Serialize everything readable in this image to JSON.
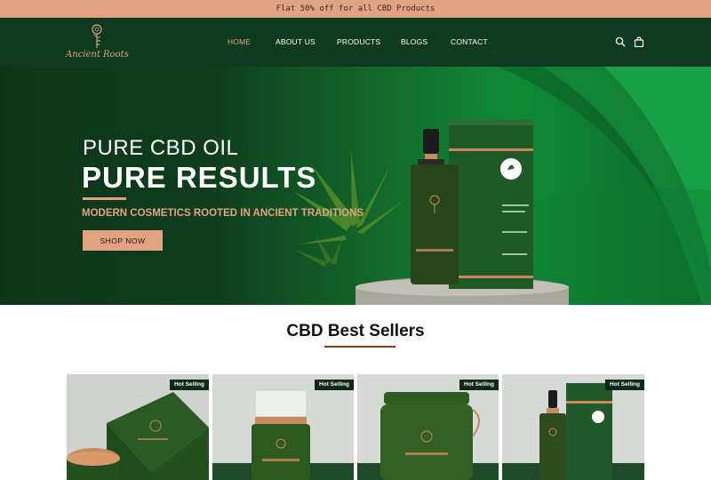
{
  "announcement": "Flat 50% off for all CBD Products",
  "brand": {
    "name": "Ancient Roots"
  },
  "nav": {
    "items": [
      {
        "label": "HOME",
        "active": true
      },
      {
        "label": "ABOUT US",
        "active": false
      },
      {
        "label": "PRODUCTS",
        "active": false
      },
      {
        "label": "BLOGS",
        "active": false
      },
      {
        "label": "CONTACT",
        "active": false
      }
    ],
    "icons": [
      "search-icon",
      "shopping-bag-icon"
    ]
  },
  "hero": {
    "pretitle": "PURE CBD OIL",
    "title": "PURE RESULTS",
    "subtitle": "MODERN COSMETICS ROOTED IN ANCIENT TRADITIONS",
    "cta": "SHOP NOW"
  },
  "best_sellers": {
    "title": "CBD Best Sellers",
    "products": [
      {
        "badge": "Hot Selling"
      },
      {
        "badge": "Hot Selling"
      },
      {
        "badge": "Hot Selling"
      },
      {
        "badge": "Hot Selling"
      }
    ]
  },
  "colors": {
    "accent": "#e1a382",
    "header_bg": "#0f3a1f",
    "hero_green": "#0f8a36",
    "badge_bg": "#0d2a14"
  }
}
